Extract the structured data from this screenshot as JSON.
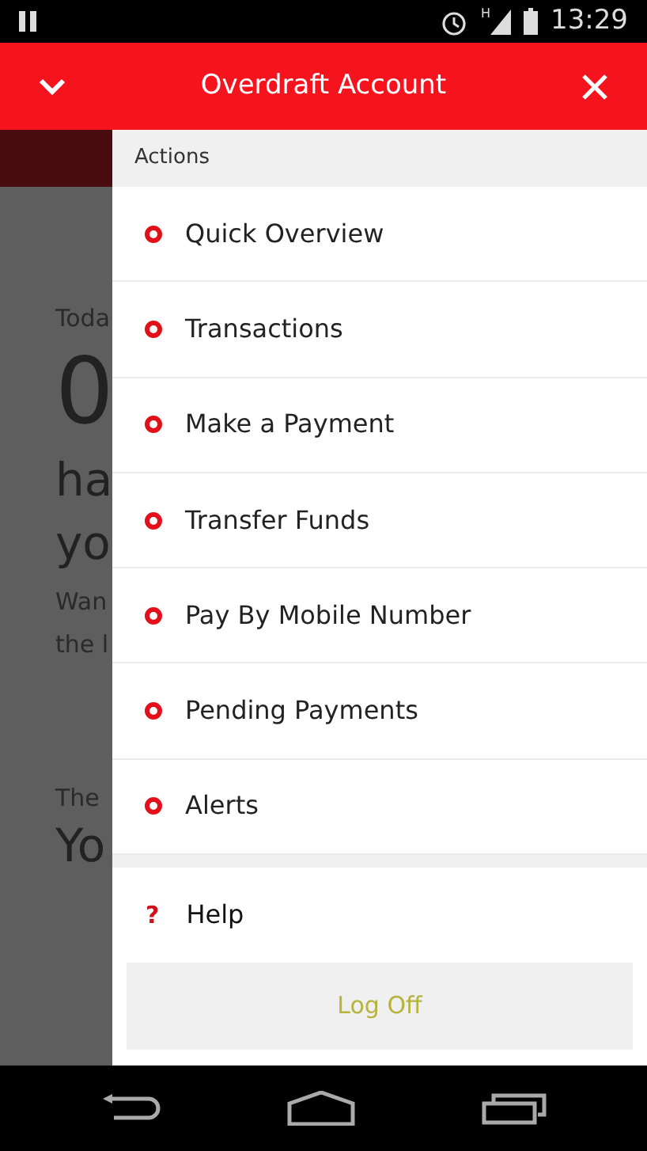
{
  "status_bar": {
    "time": "13:29",
    "network": "H"
  },
  "header": {
    "title": "Overdraft Account"
  },
  "background": {
    "texts": [
      {
        "kind": "label",
        "text": "Toda"
      },
      {
        "kind": "amount",
        "text": "0"
      },
      {
        "kind": "big",
        "text": "ha"
      },
      {
        "kind": "big",
        "text": "yo"
      },
      {
        "kind": "label",
        "text": "Wan"
      },
      {
        "kind": "label",
        "text": "the l"
      },
      {
        "kind": "gap"
      },
      {
        "kind": "label",
        "text": "The"
      },
      {
        "kind": "big",
        "text": "Yo"
      }
    ]
  },
  "drawer": {
    "section": "Actions",
    "items": [
      {
        "label": "Quick Overview"
      },
      {
        "label": "Transactions"
      },
      {
        "label": "Make a Payment"
      },
      {
        "label": "Transfer Funds"
      },
      {
        "label": "Pay By Mobile Number"
      },
      {
        "label": "Pending Payments"
      },
      {
        "label": "Alerts"
      }
    ],
    "help": {
      "icon": "?",
      "label": "Help"
    },
    "log_off": "Log Off"
  }
}
